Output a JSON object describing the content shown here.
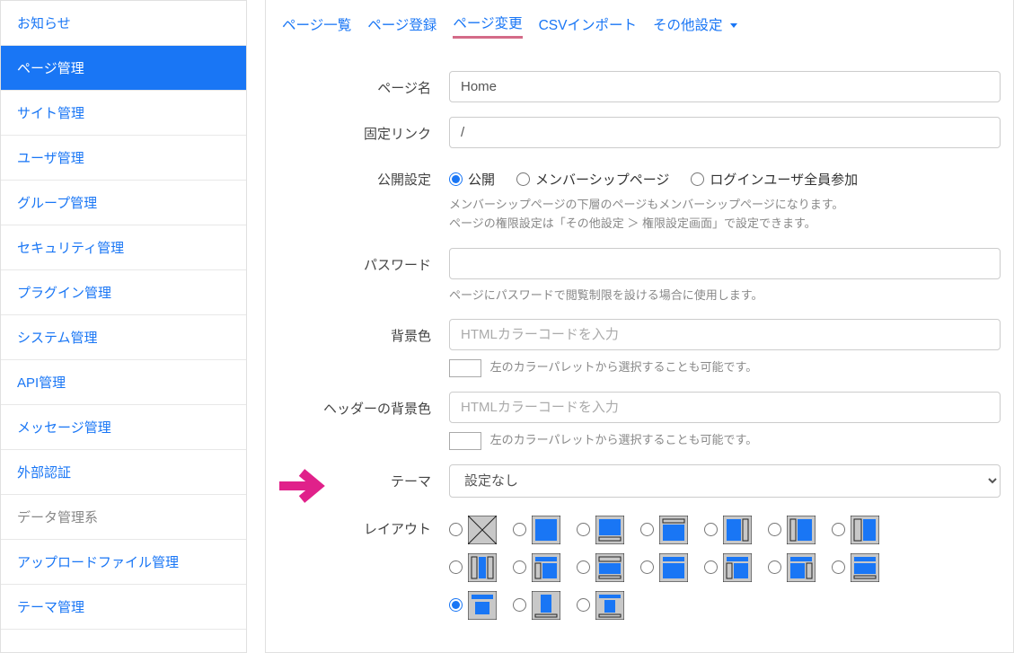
{
  "sidebar": {
    "items": [
      {
        "label": "お知らせ",
        "name": "sidebar-item-notice",
        "active": false,
        "disabled": false
      },
      {
        "label": "ページ管理",
        "name": "sidebar-item-page-mgmt",
        "active": true,
        "disabled": false
      },
      {
        "label": "サイト管理",
        "name": "sidebar-item-site-mgmt",
        "active": false,
        "disabled": false
      },
      {
        "label": "ユーザ管理",
        "name": "sidebar-item-user-mgmt",
        "active": false,
        "disabled": false
      },
      {
        "label": "グループ管理",
        "name": "sidebar-item-group-mgmt",
        "active": false,
        "disabled": false
      },
      {
        "label": "セキュリティ管理",
        "name": "sidebar-item-security-mgmt",
        "active": false,
        "disabled": false
      },
      {
        "label": "プラグイン管理",
        "name": "sidebar-item-plugin-mgmt",
        "active": false,
        "disabled": false
      },
      {
        "label": "システム管理",
        "name": "sidebar-item-system-mgmt",
        "active": false,
        "disabled": false
      },
      {
        "label": "API管理",
        "name": "sidebar-item-api-mgmt",
        "active": false,
        "disabled": false
      },
      {
        "label": "メッセージ管理",
        "name": "sidebar-item-message-mgmt",
        "active": false,
        "disabled": false
      },
      {
        "label": "外部認証",
        "name": "sidebar-item-external-auth",
        "active": false,
        "disabled": false
      },
      {
        "label": "データ管理系",
        "name": "sidebar-item-data-mgmt",
        "active": false,
        "disabled": true
      },
      {
        "label": "アップロードファイル管理",
        "name": "sidebar-item-upload-mgmt",
        "active": false,
        "disabled": false
      },
      {
        "label": "テーマ管理",
        "name": "sidebar-item-theme-mgmt",
        "active": false,
        "disabled": false
      }
    ]
  },
  "tabs": [
    {
      "label": "ページ一覧",
      "name": "tab-page-list",
      "active": false
    },
    {
      "label": "ページ登録",
      "name": "tab-page-register",
      "active": false
    },
    {
      "label": "ページ変更",
      "name": "tab-page-edit",
      "active": true
    },
    {
      "label": "CSVインポート",
      "name": "tab-csv-import",
      "active": false
    },
    {
      "label": "その他設定",
      "name": "tab-other-settings",
      "active": false,
      "dropdown": true
    }
  ],
  "form": {
    "page_name": {
      "label": "ページ名",
      "value": "Home"
    },
    "fixed_link": {
      "label": "固定リンク",
      "value": "/"
    },
    "visibility": {
      "label": "公開設定",
      "options": [
        {
          "label": "公開",
          "checked": true
        },
        {
          "label": "メンバーシップページ",
          "checked": false
        },
        {
          "label": "ログインユーザ全員参加",
          "checked": false
        }
      ],
      "help_line1": "メンバーシップページの下層のページもメンバーシップページになります。",
      "help_line2": "ページの権限設定は「その他設定 ＞ 権限設定画面」で設定できます。"
    },
    "password": {
      "label": "パスワード",
      "value": "",
      "help": "ページにパスワードで閲覧制限を設ける場合に使用します。"
    },
    "bgcolor": {
      "label": "背景色",
      "placeholder": "HTMLカラーコードを入力",
      "help": "左のカラーパレットから選択することも可能です。"
    },
    "header_bgcolor": {
      "label": "ヘッダーの背景色",
      "placeholder": "HTMLカラーコードを入力",
      "help": "左のカラーパレットから選択することも可能です。"
    },
    "theme": {
      "label": "テーマ",
      "selected": "設定なし"
    },
    "layout": {
      "label": "レイアウト"
    }
  }
}
